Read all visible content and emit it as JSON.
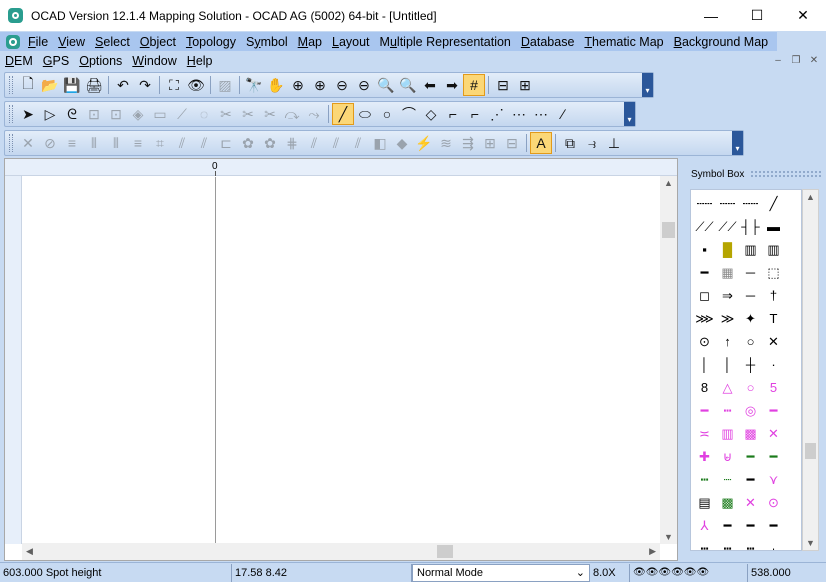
{
  "window": {
    "title": "OCAD Version 12.1.4  Mapping Solution - OCAD AG (5002) 64-bit - [Untitled]",
    "controls": {
      "minimize": "—",
      "maximize": "☐",
      "close": "✕"
    }
  },
  "menu": {
    "row1": [
      {
        "label": "File",
        "accel": "F"
      },
      {
        "label": "View",
        "accel": "V"
      },
      {
        "label": "Select",
        "accel": "S"
      },
      {
        "label": "Object",
        "accel": "O"
      },
      {
        "label": "Topology",
        "accel": "T"
      },
      {
        "label": "Symbol",
        "accel": "y"
      },
      {
        "label": "Map",
        "accel": "M"
      },
      {
        "label": "Layout",
        "accel": "L"
      },
      {
        "label": "Multiple Representation",
        "accel": "u"
      },
      {
        "label": "Database",
        "accel": "D"
      },
      {
        "label": "Thematic Map",
        "accel": "T"
      },
      {
        "label": "Background Map",
        "accel": "B"
      }
    ],
    "row2": [
      {
        "label": "DEM",
        "accel": "D"
      },
      {
        "label": "GPS",
        "accel": "G"
      },
      {
        "label": "Options",
        "accel": "O"
      },
      {
        "label": "Window",
        "accel": "W"
      },
      {
        "label": "Help",
        "accel": "H"
      }
    ],
    "mdi": {
      "minimize": "–",
      "restore": "❐",
      "close": "✕"
    }
  },
  "toolbar1": {
    "groups": [
      [
        "🗋",
        "📂",
        "💾",
        "🖨"
      ],
      [
        "↶",
        "↷"
      ],
      [
        "⛶",
        "👁"
      ],
      [
        "▨"
      ],
      [
        "🔭",
        "✋",
        "⊕",
        "⊕",
        "⊖",
        "⊖",
        "🔍",
        "🔍",
        "⬅",
        "➡",
        "#"
      ],
      [
        "⊟",
        "⊞"
      ]
    ]
  },
  "toolbar2": {
    "groups": [
      [
        "➤",
        "▷",
        "ᘓ",
        "⊡",
        "⊡",
        "◈",
        "▭",
        "⟋",
        "◌",
        "✂",
        "✂",
        "✂",
        "⤼",
        "⤳"
      ],
      [
        "╱",
        "⬭",
        "○",
        "⌒",
        "◇",
        "⌐",
        "⌐",
        "⋰",
        "⋯",
        "⋯",
        "∕"
      ]
    ]
  },
  "toolbar3": {
    "groups": [
      [
        "✕",
        "⊘",
        "≡",
        "⦀",
        "⦀",
        "≡",
        "⌗",
        "⫽",
        "⫽",
        "⊏",
        "✿",
        "✿",
        "⋕",
        "⫽",
        "⫽",
        "⫽",
        "◧",
        "◆",
        "⚡",
        "≋",
        "⇶",
        "⊞",
        "⊟"
      ],
      [
        "A"
      ],
      [
        "⧉",
        "⥽",
        "⊥"
      ]
    ]
  },
  "ruler": {
    "zero_label": "0"
  },
  "symbol_box": {
    "title": "Symbol Box",
    "symbols": [
      {
        "glyph": "┄┄",
        "color": "#000"
      },
      {
        "glyph": "┄┄",
        "color": "#000"
      },
      {
        "glyph": "┄┄",
        "color": "#000"
      },
      {
        "glyph": "╱",
        "color": "#000"
      },
      {
        "glyph": "⟋⟋",
        "color": "#000"
      },
      {
        "glyph": "⟋⟋",
        "color": "#000"
      },
      {
        "glyph": "┤├",
        "color": "#000"
      },
      {
        "glyph": "▬",
        "color": "#000"
      },
      {
        "glyph": "▪",
        "color": "#000"
      },
      {
        "glyph": "█",
        "color": "#b5a500"
      },
      {
        "glyph": "▥",
        "color": "#000"
      },
      {
        "glyph": "▥",
        "color": "#000"
      },
      {
        "glyph": "━",
        "color": "#000"
      },
      {
        "glyph": "▦",
        "color": "#888"
      },
      {
        "glyph": "─",
        "color": "#000"
      },
      {
        "glyph": "⬚",
        "color": "#000"
      },
      {
        "glyph": "◻",
        "color": "#000"
      },
      {
        "glyph": "⇒",
        "color": "#000"
      },
      {
        "glyph": "─",
        "color": "#000"
      },
      {
        "glyph": "†",
        "color": "#000"
      },
      {
        "glyph": "⋙",
        "color": "#000"
      },
      {
        "glyph": "≫",
        "color": "#000"
      },
      {
        "glyph": "✦",
        "color": "#000"
      },
      {
        "glyph": "T",
        "color": "#000"
      },
      {
        "glyph": "⊙",
        "color": "#000"
      },
      {
        "glyph": "↑",
        "color": "#000"
      },
      {
        "glyph": "○",
        "color": "#000"
      },
      {
        "glyph": "✕",
        "color": "#000"
      },
      {
        "glyph": "│",
        "color": "#000"
      },
      {
        "glyph": "│",
        "color": "#000"
      },
      {
        "glyph": "┼",
        "color": "#000"
      },
      {
        "glyph": "·",
        "color": "#000"
      },
      {
        "glyph": "8",
        "color": "#000"
      },
      {
        "glyph": "△",
        "color": "#e040e0"
      },
      {
        "glyph": "○",
        "color": "#e040e0"
      },
      {
        "glyph": "5",
        "color": "#e040e0"
      },
      {
        "glyph": "━",
        "color": "#e040e0"
      },
      {
        "glyph": "┅",
        "color": "#e040e0"
      },
      {
        "glyph": "◎",
        "color": "#e040e0"
      },
      {
        "glyph": "━",
        "color": "#e040e0"
      },
      {
        "glyph": "≍",
        "color": "#e040e0"
      },
      {
        "glyph": "▥",
        "color": "#e040e0"
      },
      {
        "glyph": "▩",
        "color": "#e040e0"
      },
      {
        "glyph": "✕",
        "color": "#e040e0"
      },
      {
        "glyph": "✚",
        "color": "#e040e0"
      },
      {
        "glyph": "⊌",
        "color": "#e040e0"
      },
      {
        "glyph": "━",
        "color": "#1a7a1a"
      },
      {
        "glyph": "━",
        "color": "#1a7a1a"
      },
      {
        "glyph": "┅",
        "color": "#1a7a1a"
      },
      {
        "glyph": "┈",
        "color": "#1a7a1a"
      },
      {
        "glyph": "━",
        "color": "#000"
      },
      {
        "glyph": "⋎",
        "color": "#e040e0"
      },
      {
        "glyph": "▤",
        "color": "#000"
      },
      {
        "glyph": "▩",
        "color": "#1a7a1a"
      },
      {
        "glyph": "✕",
        "color": "#e040e0"
      },
      {
        "glyph": "⊙",
        "color": "#e040e0"
      },
      {
        "glyph": "⅄",
        "color": "#e040e0"
      },
      {
        "glyph": "━",
        "color": "#000"
      },
      {
        "glyph": "━",
        "color": "#000"
      },
      {
        "glyph": "━",
        "color": "#000"
      },
      {
        "glyph": "┅",
        "color": "#000"
      },
      {
        "glyph": "┅",
        "color": "#000"
      },
      {
        "glyph": "┅",
        "color": "#000"
      },
      {
        "glyph": "╷",
        "color": "#000"
      }
    ]
  },
  "status": {
    "selected_symbol": "603.000 Spot height",
    "coordinates": "17.58   8.42",
    "mode": "Normal Mode",
    "zoom": "8.0X",
    "scale_icons": "👁👁👁👁👁👁",
    "scale": "538.000"
  }
}
